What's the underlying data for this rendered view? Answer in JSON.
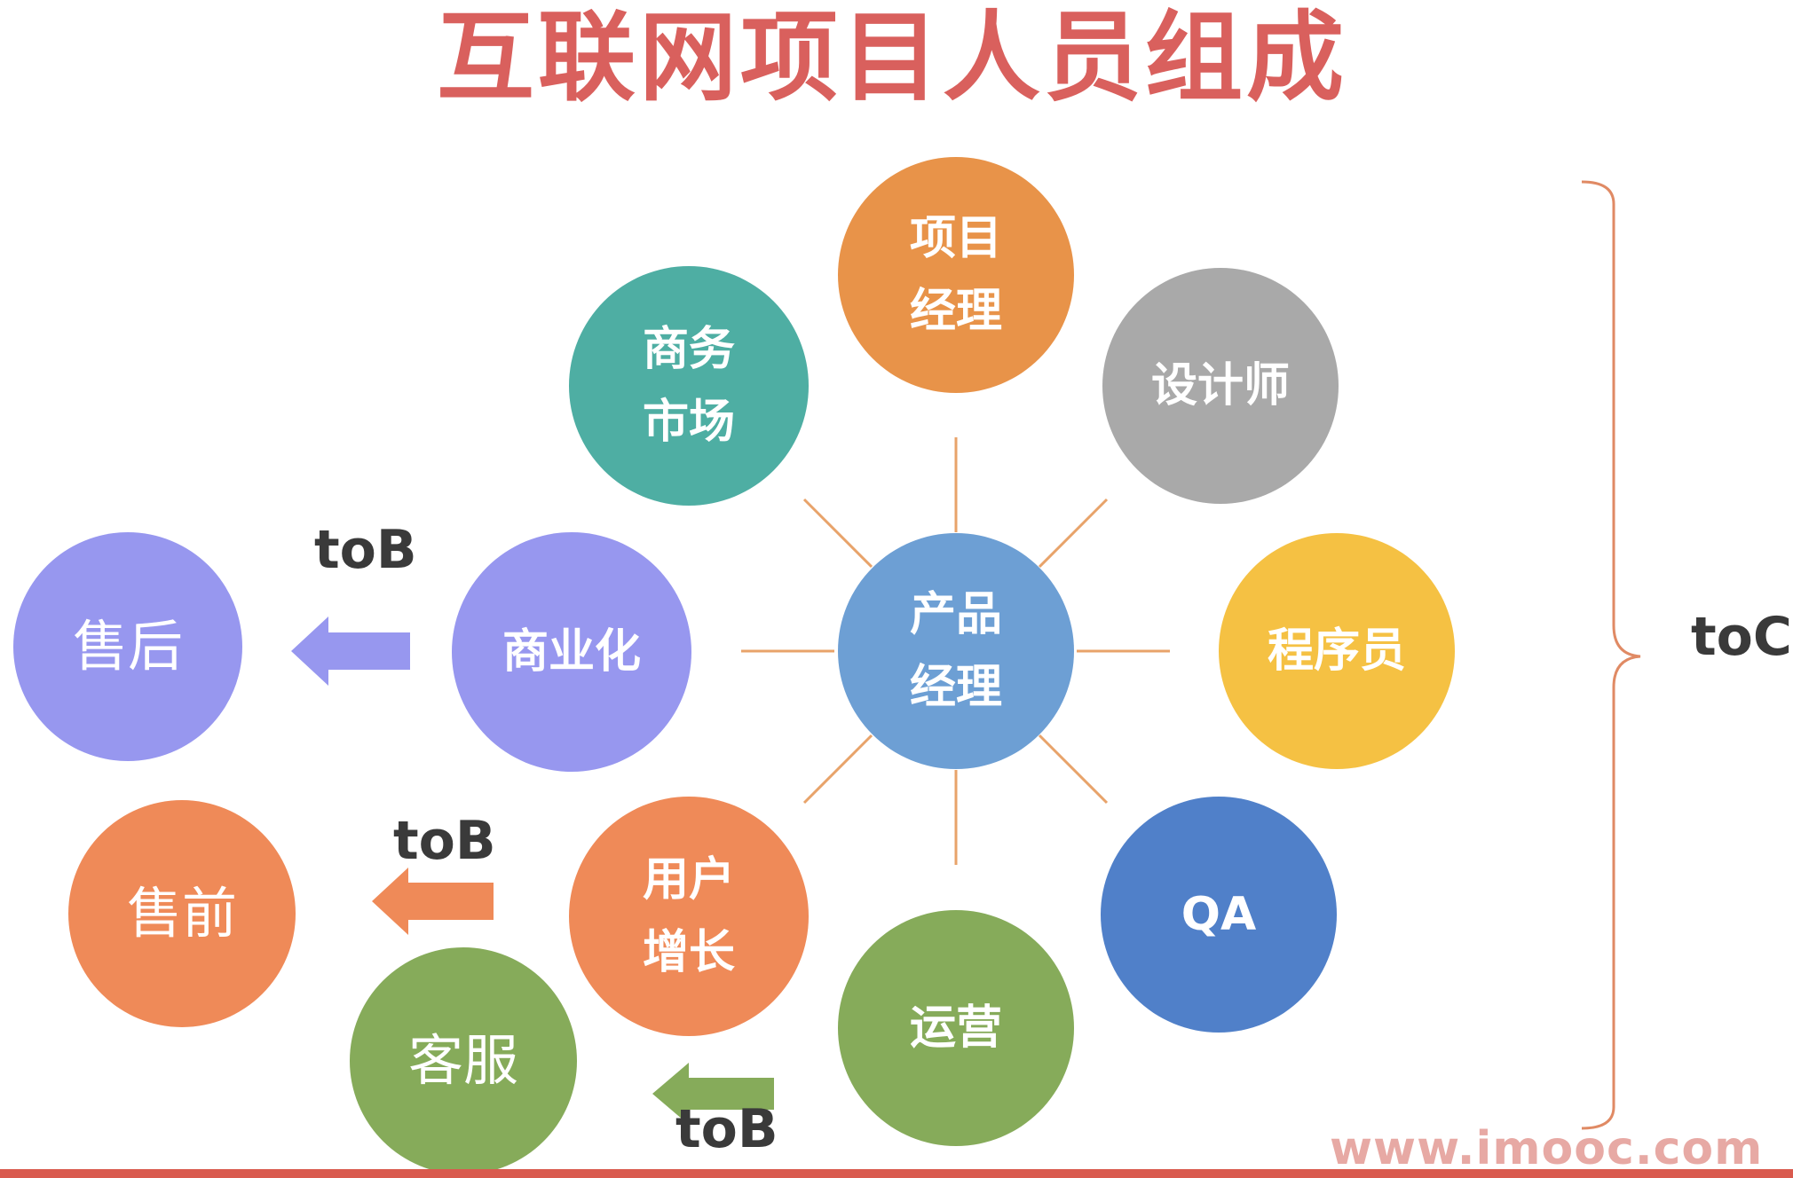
{
  "title": "互联网项目人员组成",
  "center": {
    "label": "产品\n经理",
    "color": "#6d9fd4"
  },
  "roles": [
    {
      "id": "pm",
      "label": "项目\n经理",
      "color": "#e89349"
    },
    {
      "id": "designer",
      "label": "设计师",
      "color": "#a9a9a9"
    },
    {
      "id": "programmer",
      "label": "程序员",
      "color": "#f5c143"
    },
    {
      "id": "qa",
      "label": "QA",
      "color": "#5080c9"
    },
    {
      "id": "ops",
      "label": "运营",
      "color": "#86ab5a"
    },
    {
      "id": "growth",
      "label": "用户\n增长",
      "color": "#ef8a58"
    },
    {
      "id": "commercial",
      "label": "商业化",
      "color": "#9797ef"
    },
    {
      "id": "bizmarket",
      "label": "商务\n市场",
      "color": "#4eaea3"
    }
  ],
  "tob_roles": [
    {
      "id": "aftersales",
      "label": "售后",
      "color": "#9797ef"
    },
    {
      "id": "presales",
      "label": "售前",
      "color": "#ef8a58"
    },
    {
      "id": "support",
      "label": "客服",
      "color": "#86ab5a"
    }
  ],
  "tob_label": "toB",
  "toc_label": "toC",
  "watermark": "www.imooc.com",
  "colors": {
    "title": "#d9605d",
    "spoke": "#e8a36a",
    "brace": "#e08a64"
  }
}
